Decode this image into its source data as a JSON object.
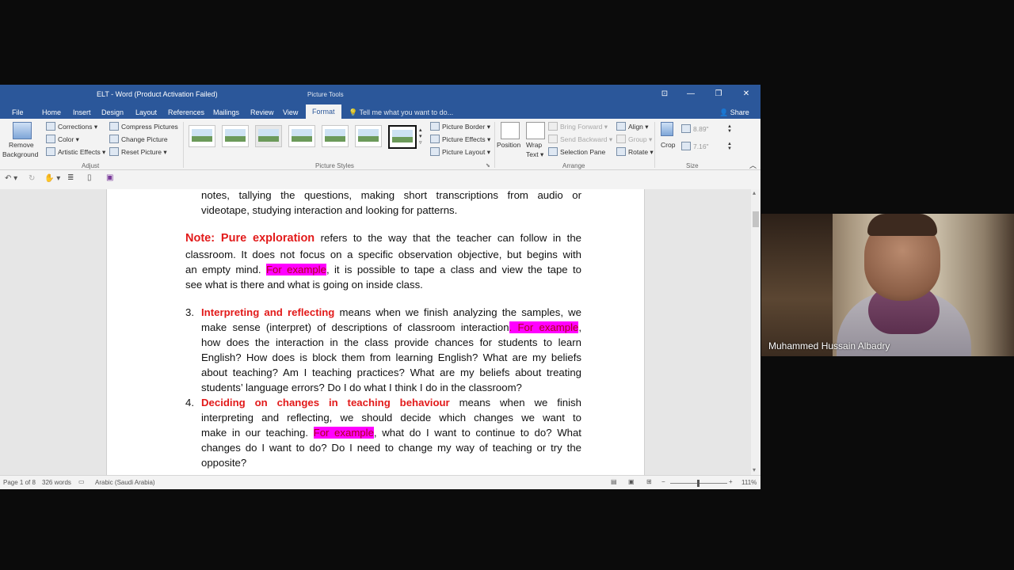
{
  "window": {
    "title": "ELT - Word (Product Activation Failed)",
    "contextual_tab_group": "Picture Tools",
    "controls": {
      "ribbon_display": "⊡",
      "minimize": "—",
      "restore": "❐",
      "close": "✕"
    }
  },
  "tabs": [
    "File",
    "Home",
    "Insert",
    "Design",
    "Layout",
    "References",
    "Mailings",
    "Review",
    "View",
    "Format"
  ],
  "active_tab": "Format",
  "tell_me": "Tell me what you want to do...",
  "share": "Share",
  "ribbon": {
    "adjust": {
      "remove_background_line1": "Remove",
      "remove_background_line2": "Background",
      "corrections": "Corrections ▾",
      "color": "Color ▾",
      "artistic_effects": "Artistic Effects ▾",
      "compress_pictures": "Compress Pictures",
      "change_picture": "Change Picture",
      "reset_picture": "Reset Picture ▾",
      "label": "Adjust"
    },
    "picture_styles": {
      "label": "Picture Styles",
      "picture_border": "Picture Border ▾",
      "picture_effects": "Picture Effects ▾",
      "picture_layout": "Picture Layout ▾"
    },
    "arrange": {
      "label": "Arrange",
      "position": "Position",
      "wrap_text_line1": "Wrap",
      "wrap_text_line2": "Text ▾",
      "bring_forward": "Bring Forward ▾",
      "send_backward": "Send Backward ▾",
      "selection_pane": "Selection Pane",
      "align": "Align ▾",
      "group": "Group ▾",
      "rotate": "Rotate ▾"
    },
    "size": {
      "label": "Size",
      "crop": "Crop",
      "height": "8.89\"",
      "width": "7.16\""
    }
  },
  "document": {
    "lines": [
      [
        "notes, tallying the questions, making short transcriptions from audio or"
      ],
      [
        "videotape, studying interaction and looking for patterns."
      ],
      [
        "Note: Pure exploration",
        " refers to the way that the teacher can follow in the"
      ],
      [
        "classroom. It does not focus on a specific observation objective, but begins with"
      ],
      [
        "an empty mind. ",
        "For example",
        ", it is possible to tape a class and view the tape to"
      ],
      [
        "see what is there and what is going on inside class."
      ],
      [
        "3.",
        "Interpreting and reflecting",
        " means when we finish analyzing the samples, we"
      ],
      [
        "make sense (interpret) of descriptions of classroom interaction",
        ". For example",
        ","
      ],
      [
        "how does the interaction in the class provide chances for students to learn"
      ],
      [
        "English? How does is block them from learning English? What are my beliefs"
      ],
      [
        "about teaching? Am I teaching practices? What are my beliefs about treating"
      ],
      [
        "students’ language errors? Do I do what I think I do in the classroom?"
      ],
      [
        "4.",
        "Deciding on changes in teaching behaviour",
        " means when we finish"
      ],
      [
        "interpreting and reflecting, we should decide which changes we want to"
      ],
      [
        "make in our teaching. ",
        "For example",
        ", what do I want to continue to do? What"
      ],
      [
        "changes do I want to do? Do I need to change my way of teaching or try the"
      ],
      [
        "opposite?"
      ]
    ]
  },
  "status_bar": {
    "page": "Page 1 of 8",
    "words": "326 words",
    "language": "Arabic (Saudi Arabia)",
    "zoom": "111%",
    "zoom_minus": "−",
    "zoom_plus": "+"
  },
  "video": {
    "participant_name": "Muhammed Hussain Albadry"
  },
  "colors": {
    "word_blue": "#2b579a",
    "heading_red": "#e21a1a",
    "highlight_magenta": "#ff00ff"
  }
}
